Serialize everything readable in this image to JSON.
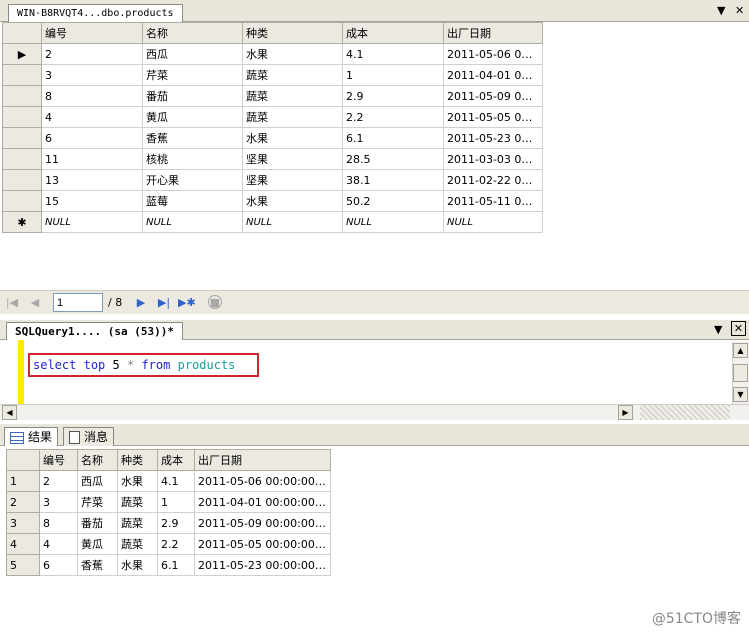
{
  "top_tab": {
    "title": "WIN-B8RVQT4...dbo.products",
    "close_symbol": "✕",
    "menu_symbol": "▼"
  },
  "data_grid": {
    "columns": [
      "编号",
      "名称",
      "种类",
      "成本",
      "出厂日期"
    ],
    "rows": [
      [
        "2",
        "西瓜",
        "水果",
        "4.1",
        "2011-05-06 00:..."
      ],
      [
        "3",
        "芹菜",
        "蔬菜",
        "1",
        "2011-04-01 00:..."
      ],
      [
        "8",
        "番茄",
        "蔬菜",
        "2.9",
        "2011-05-09 00:..."
      ],
      [
        "4",
        "黄瓜",
        "蔬菜",
        "2.2",
        "2011-05-05 00:..."
      ],
      [
        "6",
        "香蕉",
        "水果",
        "6.1",
        "2011-05-23 00:..."
      ],
      [
        "11",
        "核桃",
        "坚果",
        "28.5",
        "2011-03-03 00:..."
      ],
      [
        "13",
        "开心果",
        "坚果",
        "38.1",
        "2011-02-22 00:..."
      ],
      [
        "15",
        "蓝莓",
        "水果",
        "50.2",
        "2011-05-11 00:..."
      ]
    ],
    "new_row": [
      "NULL",
      "NULL",
      "NULL",
      "NULL",
      "NULL"
    ],
    "current_row_marker": "▶",
    "new_row_marker": "✱"
  },
  "navigator": {
    "position": "1",
    "total": "/ 8"
  },
  "query_tab": {
    "title": "SQLQuery1....  (sa (53))*",
    "close_symbol": "✕",
    "menu_symbol": "▼"
  },
  "editor": {
    "tokens": {
      "select": "select",
      "top": "top",
      "num": "5",
      "star": "*",
      "from": "from",
      "table": "products"
    }
  },
  "results_tabs": {
    "results_label": "结果",
    "messages_label": "消息"
  },
  "results_grid": {
    "columns": [
      "编号",
      "名称",
      "种类",
      "成本",
      "出厂日期"
    ],
    "rows": [
      [
        "1",
        "2",
        "西瓜",
        "水果",
        "4.1",
        "2011-05-06 00:00:00.000"
      ],
      [
        "2",
        "3",
        "芹菜",
        "蔬菜",
        "1",
        "2011-04-01 00:00:00.000"
      ],
      [
        "3",
        "8",
        "番茄",
        "蔬菜",
        "2.9",
        "2011-05-09 00:00:00.000"
      ],
      [
        "4",
        "4",
        "黄瓜",
        "蔬菜",
        "2.2",
        "2011-05-05 00:00:00.000"
      ],
      [
        "5",
        "6",
        "香蕉",
        "水果",
        "6.1",
        "2011-05-23 00:00:00.000"
      ]
    ]
  },
  "watermark": "@51CTO博客",
  "colors": {
    "highlight_border": "#d4232e",
    "keyword": "#1f1fcf",
    "object": "#199c9c",
    "gutter": "#ffea00"
  }
}
